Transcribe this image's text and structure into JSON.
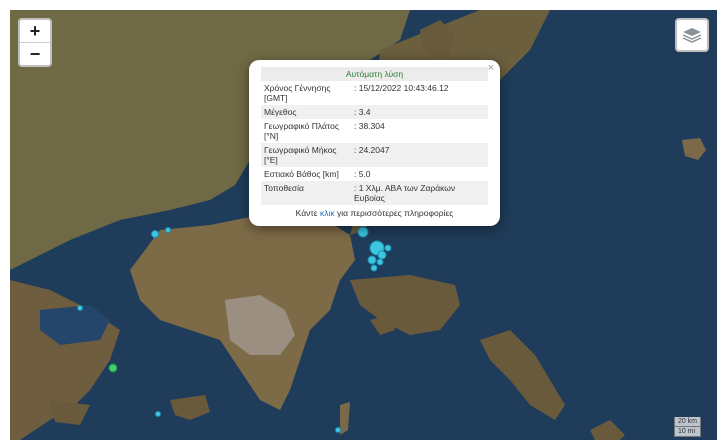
{
  "map": {
    "zoom_in_label": "+",
    "zoom_out_label": "−",
    "layers_icon": "layers-icon",
    "colors": {
      "sea": "#1f3c5a",
      "land": "#7a6a47",
      "marker": "#3ec6e0"
    }
  },
  "popup": {
    "title": "Αυτόματη λύση",
    "close_label": "×",
    "rows": [
      {
        "label": "Χρόνος Γέννησης [GMT]",
        "value": ": 15/12/2022 10:43:46.12"
      },
      {
        "label": "Μέγεθος",
        "value": ": 3.4"
      },
      {
        "label": "Γεωγραφικό Πλάτος [°N]",
        "value": ": 38.304"
      },
      {
        "label": "Γεωγραφικό Μήκος [°E]",
        "value": ": 24.2047"
      },
      {
        "label": "Εστιακό Βάθος [km]",
        "value": ": 5.0"
      },
      {
        "label": "Τοποθεσία",
        "value": ": 1 Χλμ. ΑΒΑ των Ζαράκων Ευβοίας"
      }
    ],
    "more_prefix": "Κάντε",
    "more_link": "κλικ",
    "more_suffix": "για περισσότερες πληροφορίες"
  },
  "scale": {
    "top": "20 km",
    "bottom": "10 mi"
  }
}
